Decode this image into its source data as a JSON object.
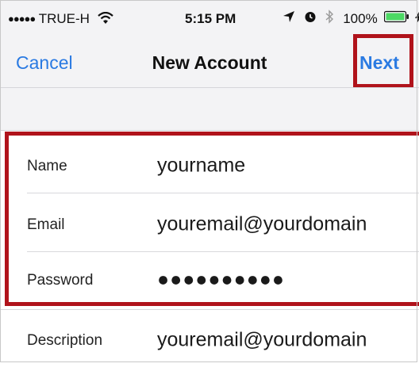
{
  "status_bar": {
    "signal_dots": "●●●●●",
    "carrier": "TRUE-H",
    "time": "5:15 PM",
    "battery": "100%"
  },
  "nav": {
    "cancel_label": "Cancel",
    "title": "New Account",
    "next_label": "Next"
  },
  "form": {
    "rows": [
      {
        "label": "Name",
        "value": "yourname"
      },
      {
        "label": "Email",
        "value": "youremail@yourdomain"
      },
      {
        "label": "Password",
        "value": "●●●●●●●●●●"
      },
      {
        "label": "Description",
        "value": "youremail@yourdomain"
      }
    ]
  },
  "colors": {
    "accent": "#2a7ae2",
    "highlight": "#b0131b",
    "header_bg": "#f3f3f5"
  },
  "icons": [
    "wifi-icon",
    "location-arrow-icon",
    "alarm-icon",
    "bluetooth-icon",
    "battery-icon",
    "charging-bolt-icon"
  ]
}
